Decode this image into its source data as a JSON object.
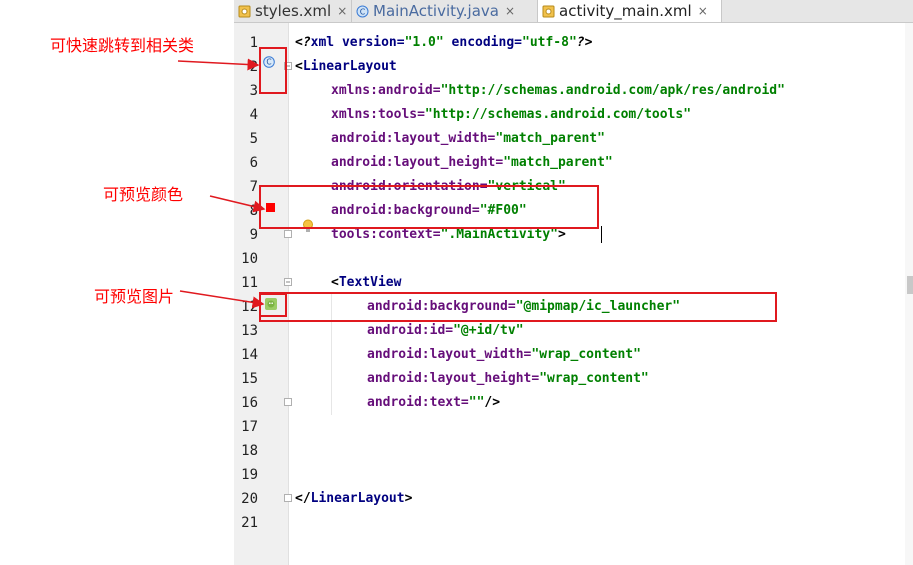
{
  "tabs": [
    {
      "label": "styles.xml",
      "close": "×"
    },
    {
      "label": "MainActivity.java",
      "close": "×"
    },
    {
      "label": "activity_main.xml",
      "close": "×"
    }
  ],
  "line_numbers": [
    "1",
    "2",
    "3",
    "4",
    "5",
    "6",
    "7",
    "8",
    "9",
    "10",
    "11",
    "12",
    "13",
    "14",
    "15",
    "16",
    "17",
    "18",
    "19",
    "20",
    "21"
  ],
  "code": {
    "l1": {
      "a": "<?",
      "b": "xml version=",
      "c": "\"1.0\"",
      "d": " encoding=",
      "e": "\"utf-8\"",
      "f": "?>"
    },
    "l2": {
      "a": "<",
      "b": "LinearLayout"
    },
    "l3": {
      "a": "xmlns:android=",
      "b": "\"http://schemas.android.com/apk/res/android\""
    },
    "l4": {
      "a": "xmlns:tools=",
      "b": "\"http://schemas.android.com/tools\""
    },
    "l5": {
      "a": "android:layout_width=",
      "b": "\"match_parent\""
    },
    "l6": {
      "a": "android:layout_height=",
      "b": "\"match_parent\""
    },
    "l7": {
      "a": "android:orientation=",
      "b": "\"vertical\""
    },
    "l8": {
      "a": "android:background=",
      "b": "\"#F00\""
    },
    "l9": {
      "a": "tools:context=",
      "b": "\".MainActivity\"",
      "c": ">"
    },
    "l11": {
      "a": "<",
      "b": "TextView"
    },
    "l12": {
      "a": "android:background=",
      "b": "\"@mipmap/ic_launcher\""
    },
    "l13": {
      "a": "android:id=",
      "b": "\"@+id/tv\""
    },
    "l14": {
      "a": "android:layout_width=",
      "b": "\"wrap_content\""
    },
    "l15": {
      "a": "android:layout_height=",
      "b": "\"wrap_content\""
    },
    "l16": {
      "a": "android:text=",
      "b": "\"\"",
      "c": "/>"
    },
    "l20": {
      "a": "</",
      "b": "LinearLayout",
      "c": ">"
    }
  },
  "annotations": {
    "jump_class": "可快速跳转到相关类",
    "preview_color": "可预览颜色",
    "preview_image": "可预览图片"
  },
  "gutter_icons": {
    "class_marker": "C",
    "color_swatch": "#ff0000",
    "image_preview": "android-launcher-icon",
    "bulb": "lightbulb-icon"
  },
  "colors": {
    "annotation_red": "#ff0000",
    "xml_tag": "#000080",
    "xml_attr": "#660e7a",
    "xml_string": "#008000"
  }
}
